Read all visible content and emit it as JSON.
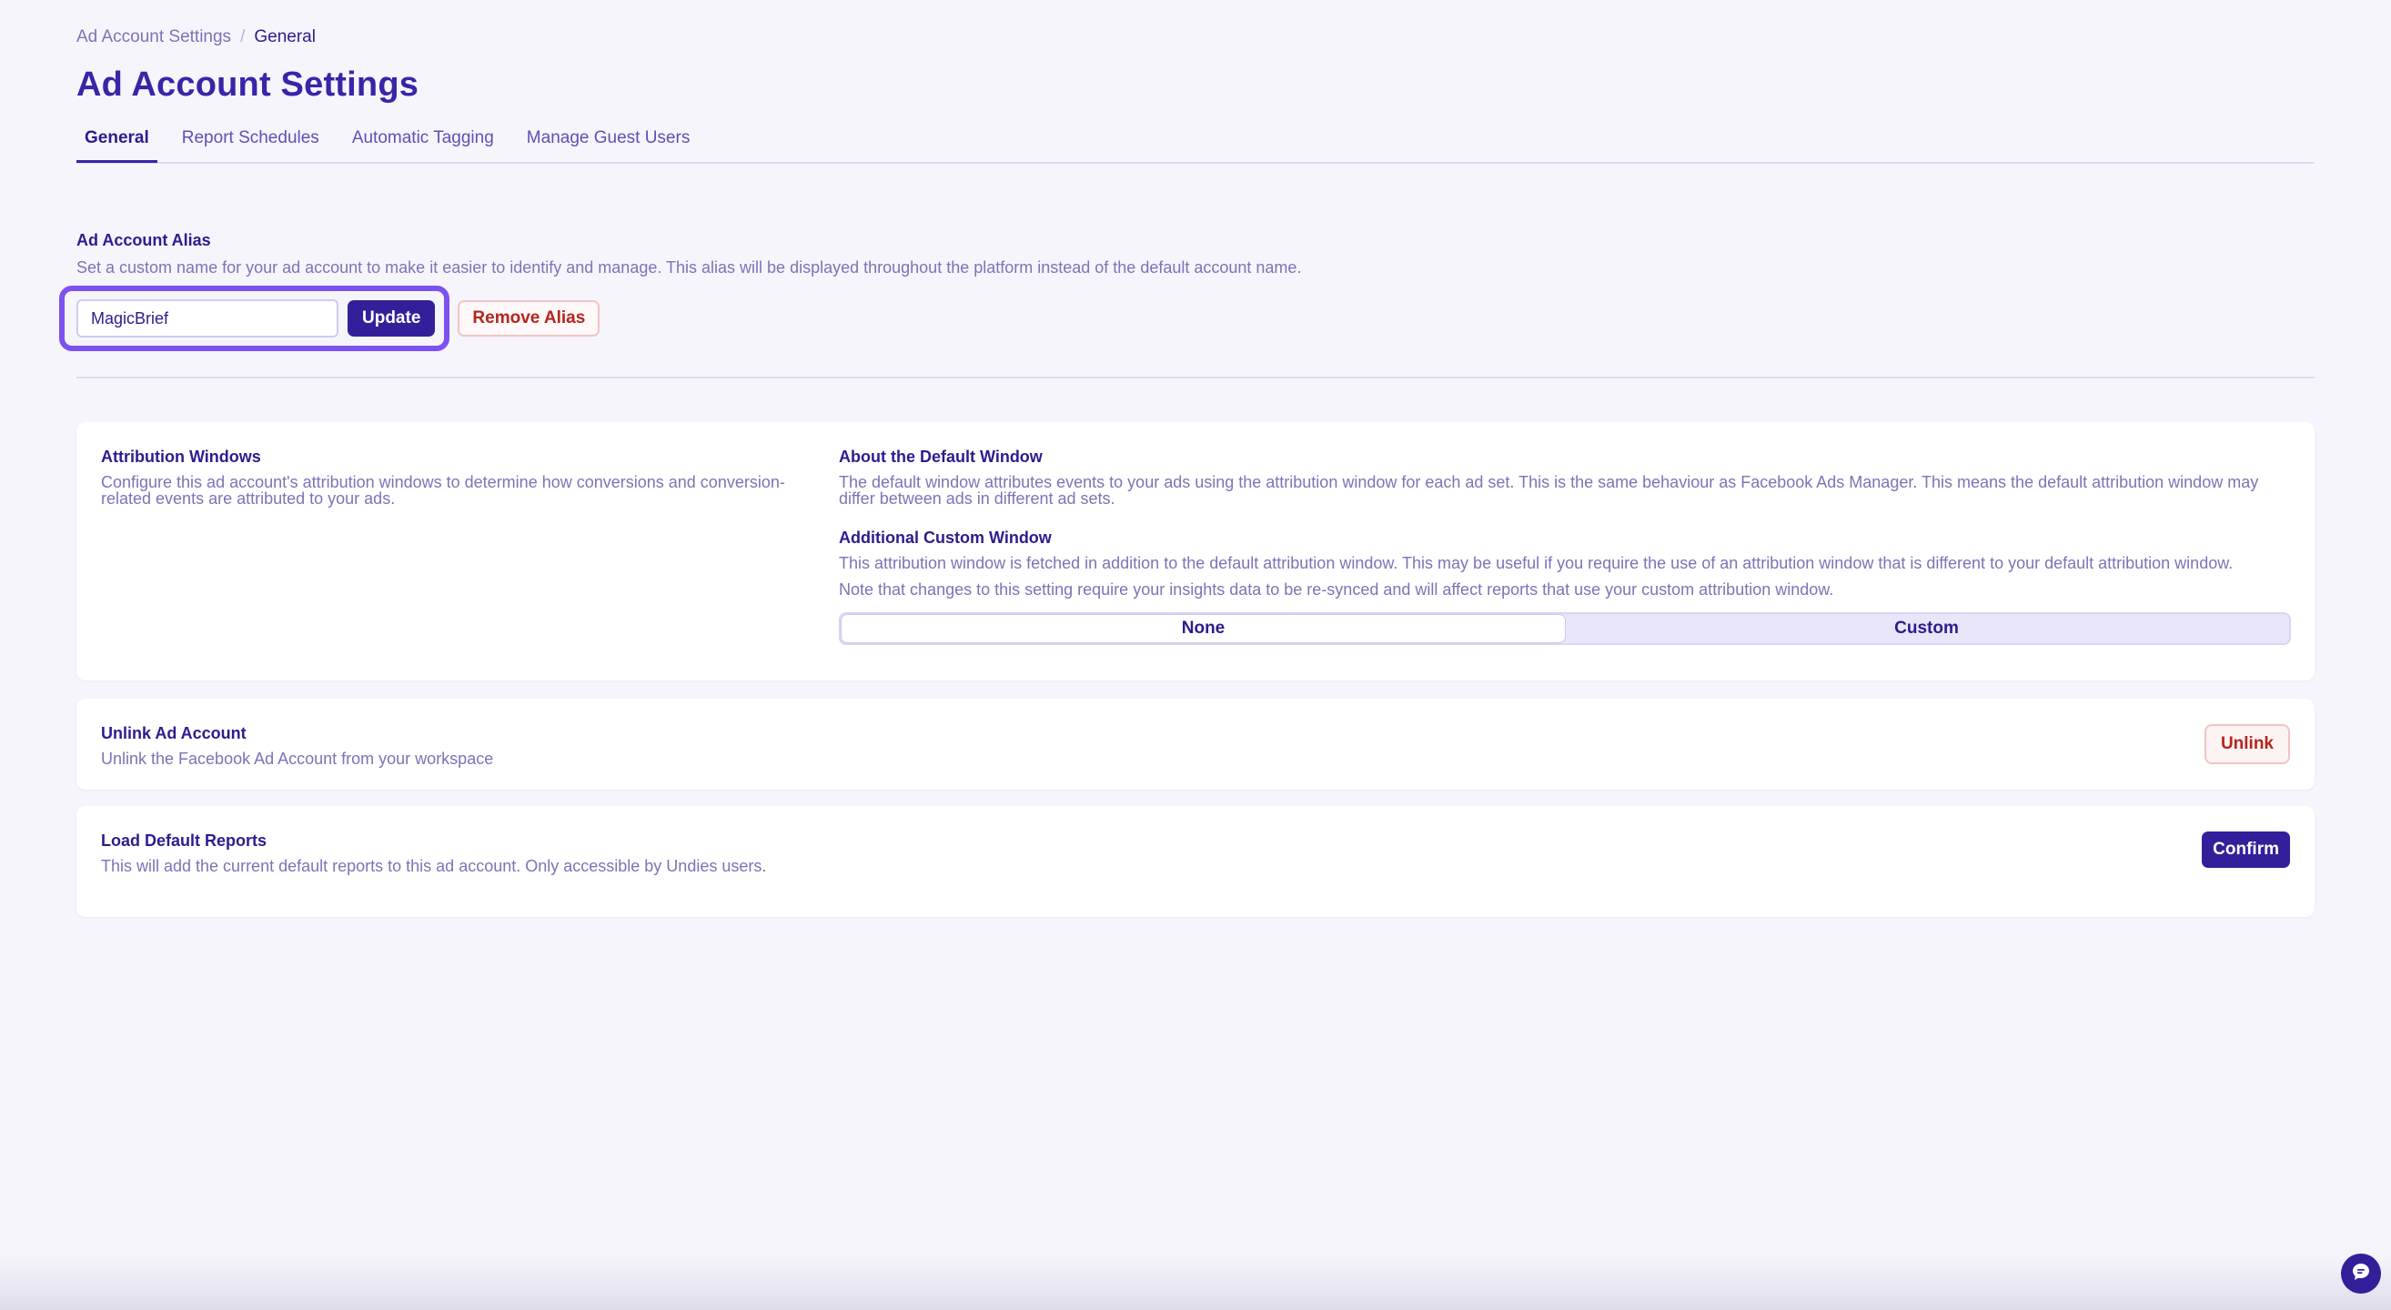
{
  "breadcrumb": {
    "parent": "Ad Account Settings",
    "separator": "/",
    "current": "General"
  },
  "page_title": "Ad Account Settings",
  "tabs": [
    {
      "label": "General",
      "active": true
    },
    {
      "label": "Report Schedules",
      "active": false
    },
    {
      "label": "Automatic Tagging",
      "active": false
    },
    {
      "label": "Manage Guest Users",
      "active": false
    }
  ],
  "alias": {
    "heading": "Ad Account Alias",
    "description": "Set a custom name for your ad account to make it easier to identify and manage. This alias will be displayed throughout the platform instead of the default account name.",
    "input_value": "MagicBrief",
    "update_label": "Update",
    "remove_label": "Remove Alias"
  },
  "attribution": {
    "heading": "Attribution Windows",
    "description": "Configure this ad account's attribution windows to determine how conversions and conversion-related events are attributed to your ads.",
    "default_window_heading": "About the Default Window",
    "default_window_text": "The default window attributes events to your ads using the attribution window for each ad set. This is the same behaviour as Facebook Ads Manager. This means the default attribution window may differ between ads in different ad sets.",
    "custom_window_heading": "Additional Custom Window",
    "custom_window_text": "This attribution window is fetched in addition to the default attribution window. This may be useful if you require the use of an attribution window that is different to your default attribution window.",
    "note": "Note that changes to this setting require your insights data to be re-synced and will affect reports that use your custom attribution window.",
    "options": [
      {
        "label": "None",
        "selected": true
      },
      {
        "label": "Custom",
        "selected": false
      }
    ]
  },
  "unlink": {
    "heading": "Unlink Ad Account",
    "description": "Unlink the Facebook Ad Account from your workspace",
    "button_label": "Unlink"
  },
  "load_reports": {
    "heading": "Load Default Reports",
    "description": "This will add the current default reports to this ad account. Only accessible by Undies users.",
    "button_label": "Confirm"
  },
  "icons": {
    "chat": "chat-bubble-icon"
  },
  "colors": {
    "primary": "#341f9a",
    "heading": "#3a24a8",
    "muted_text": "#7d73b6",
    "danger": "#b3261e",
    "highlight": "#7c52f0",
    "background": "#f6f5fc"
  }
}
